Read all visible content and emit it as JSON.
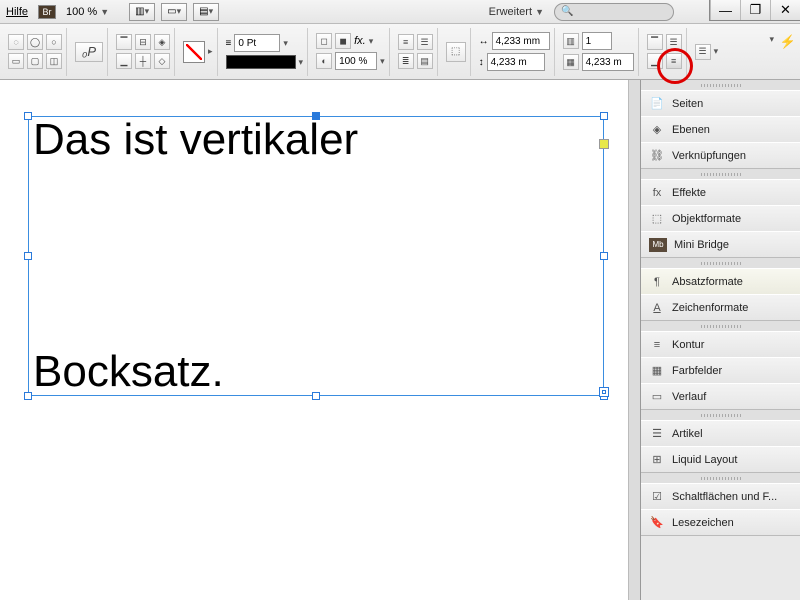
{
  "menubar": {
    "help": "Hilfe",
    "br": "Br",
    "zoom": "100 %",
    "workspace": "Erweitert",
    "search_placeholder": "🔍"
  },
  "window": {
    "min": "—",
    "max": "❐",
    "close": "✕"
  },
  "toolbar": {
    "stroke_pt": "0 Pt",
    "opacity": "100 %",
    "fx": "fx.",
    "width": "4,233 mm",
    "height": "4,233 m",
    "cols": "1"
  },
  "canvas": {
    "line1": "Das ist vertikaler",
    "line2": "Bocksatz."
  },
  "panels": {
    "g1": [
      {
        "icon": "📄",
        "label": "Seiten"
      },
      {
        "icon": "◈",
        "label": "Ebenen"
      },
      {
        "icon": "⛓",
        "label": "Verknüpfungen"
      }
    ],
    "g2": [
      {
        "icon": "fx",
        "label": "Effekte"
      },
      {
        "icon": "⬚",
        "label": "Objektformate"
      },
      {
        "icon": "Mb",
        "label": "Mini Bridge"
      }
    ],
    "g3": [
      {
        "icon": "¶",
        "label": "Absatzformate"
      },
      {
        "icon": "A",
        "label": "Zeichenformate"
      }
    ],
    "g4": [
      {
        "icon": "≡",
        "label": "Kontur"
      },
      {
        "icon": "▦",
        "label": "Farbfelder"
      },
      {
        "icon": "▭",
        "label": "Verlauf"
      }
    ],
    "g5": [
      {
        "icon": "☰",
        "label": "Artikel"
      },
      {
        "icon": "⊞",
        "label": "Liquid Layout"
      }
    ],
    "g6": [
      {
        "icon": "☑",
        "label": "Schaltflächen und F..."
      },
      {
        "icon": "🔖",
        "label": "Lesezeichen"
      }
    ]
  }
}
